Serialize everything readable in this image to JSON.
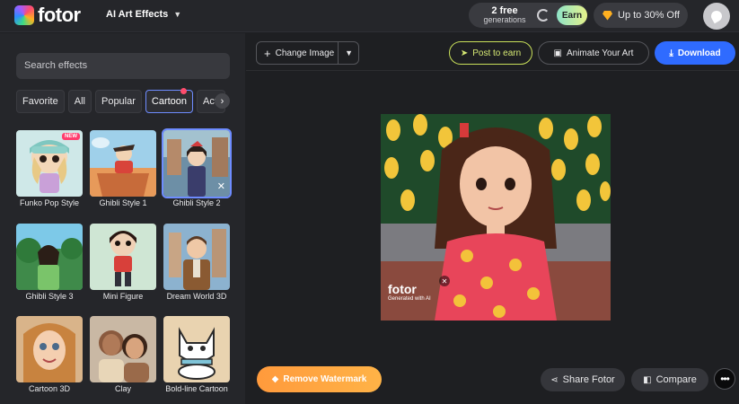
{
  "header": {
    "logo_text": "fotor",
    "menu_label": "AI Art Effects",
    "generations_count": "2 free",
    "generations_label": "generations",
    "earn_label": "Earn",
    "offer_label": "Up to 30% Off"
  },
  "sidebar": {
    "search_placeholder": "Search effects",
    "tabs": [
      "Favorite",
      "All",
      "Popular",
      "Cartoon",
      "Acti"
    ],
    "effects": [
      {
        "label": "Funko Pop Style",
        "badge": "NEW"
      },
      {
        "label": "Ghibli Style 1"
      },
      {
        "label": "Ghibli Style 2"
      },
      {
        "label": "Ghibli Style 3"
      },
      {
        "label": "Mini Figure"
      },
      {
        "label": "Dream World 3D"
      },
      {
        "label": "Cartoon 3D"
      },
      {
        "label": "Clay"
      },
      {
        "label": "Bold-line Cartoon"
      }
    ]
  },
  "toolbar": {
    "change_image": "Change Image",
    "post_to_earn": "Post to earn",
    "animate": "Animate Your Art",
    "download": "Download"
  },
  "canvas": {
    "watermark_title": "fotor",
    "watermark_sub": "Generated with AI"
  },
  "footer": {
    "remove_watermark": "Remove Watermark",
    "share": "Share Fotor",
    "compare": "Compare"
  },
  "colors": {
    "accent": "#2f6bff",
    "selected_outline": "#6e8cff",
    "orange": "#ff9a3c",
    "badge": "#ff3d6e"
  }
}
